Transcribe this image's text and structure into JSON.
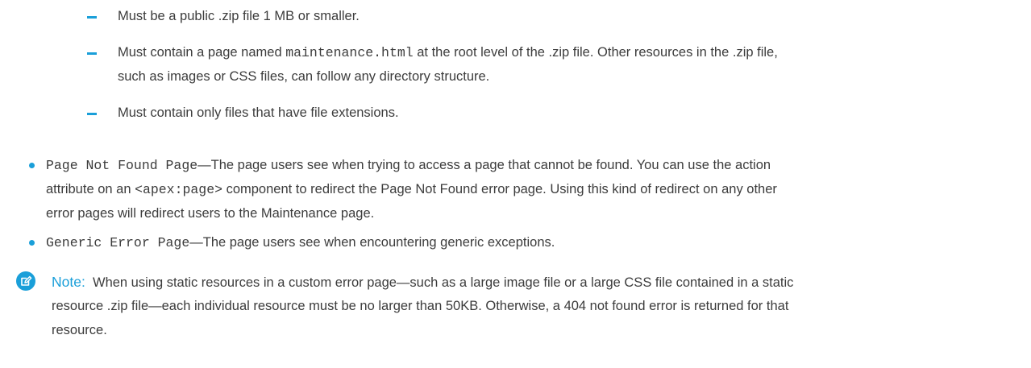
{
  "sub_items": [
    {
      "text": "Must be a public .zip file 1 MB or smaller."
    },
    {
      "before": "Must contain a page named ",
      "code": "maintenance.html",
      "after": " at the root level of the .zip file. Other resources in the .zip file,",
      "line2": "such as images or CSS files, can follow any directory structure."
    },
    {
      "text": "Must contain only files that have file extensions."
    }
  ],
  "bullets": [
    {
      "code": "Page Not Found Page",
      "l1": "—The page users see when trying to access a page that cannot be found. You can use the action",
      "l2_pre": "attribute on an ",
      "l2_code": "<apex:page>",
      "l2_post": " component to redirect the Page Not Found error page. Using this kind of redirect on any other",
      "l3": "error pages will redirect users to the Maintenance page."
    },
    {
      "code": "Generic Error Page",
      "text": "—The page users see when encountering generic exceptions."
    }
  ],
  "note": {
    "label": "Note:",
    "l1": "When using static resources in a custom error page—such as a large image file or a large CSS file contained in a static",
    "l2": "resource .zip file—each individual resource must be no larger than 50KB.  Otherwise, a 404 not found error is returned for that",
    "l3": "resource.",
    "icon": "note-edit-icon",
    "accent_color": "#1a9fd9"
  }
}
